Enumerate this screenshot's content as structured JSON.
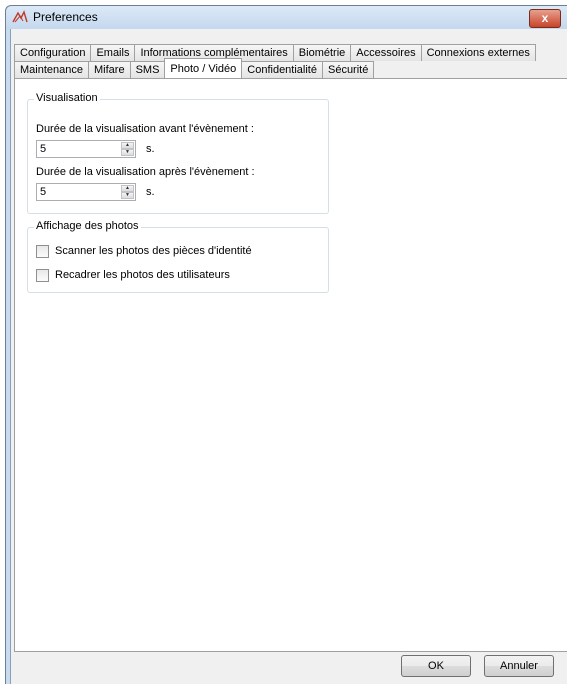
{
  "window": {
    "title": "Preferences",
    "close_label": "x"
  },
  "tabs_row1": [
    {
      "label": "Configuration"
    },
    {
      "label": "Emails"
    },
    {
      "label": "Informations complémentaires"
    },
    {
      "label": "Biométrie"
    },
    {
      "label": "Accessoires"
    },
    {
      "label": "Connexions externes"
    }
  ],
  "tabs_row2": [
    {
      "label": "Maintenance"
    },
    {
      "label": "Mifare"
    },
    {
      "label": "SMS"
    },
    {
      "label": "Photo / Vidéo",
      "active": true
    },
    {
      "label": "Confidentialité"
    },
    {
      "label": "Sécurité"
    }
  ],
  "visualisation": {
    "legend": "Visualisation",
    "before_label": "Durée de la visualisation avant l'évènement :",
    "before_value": "5",
    "before_unit": "s.",
    "after_label": "Durée de la visualisation après l'évènement :",
    "after_value": "5",
    "after_unit": "s."
  },
  "photos": {
    "legend": "Affichage des photos",
    "scan_id_label": "Scanner les photos des pièces d'identité",
    "scan_id_checked": false,
    "crop_label": "Recadrer les photos des utilisateurs",
    "crop_checked": false
  },
  "footer": {
    "ok_label": "OK",
    "cancel_label": "Annuler"
  }
}
